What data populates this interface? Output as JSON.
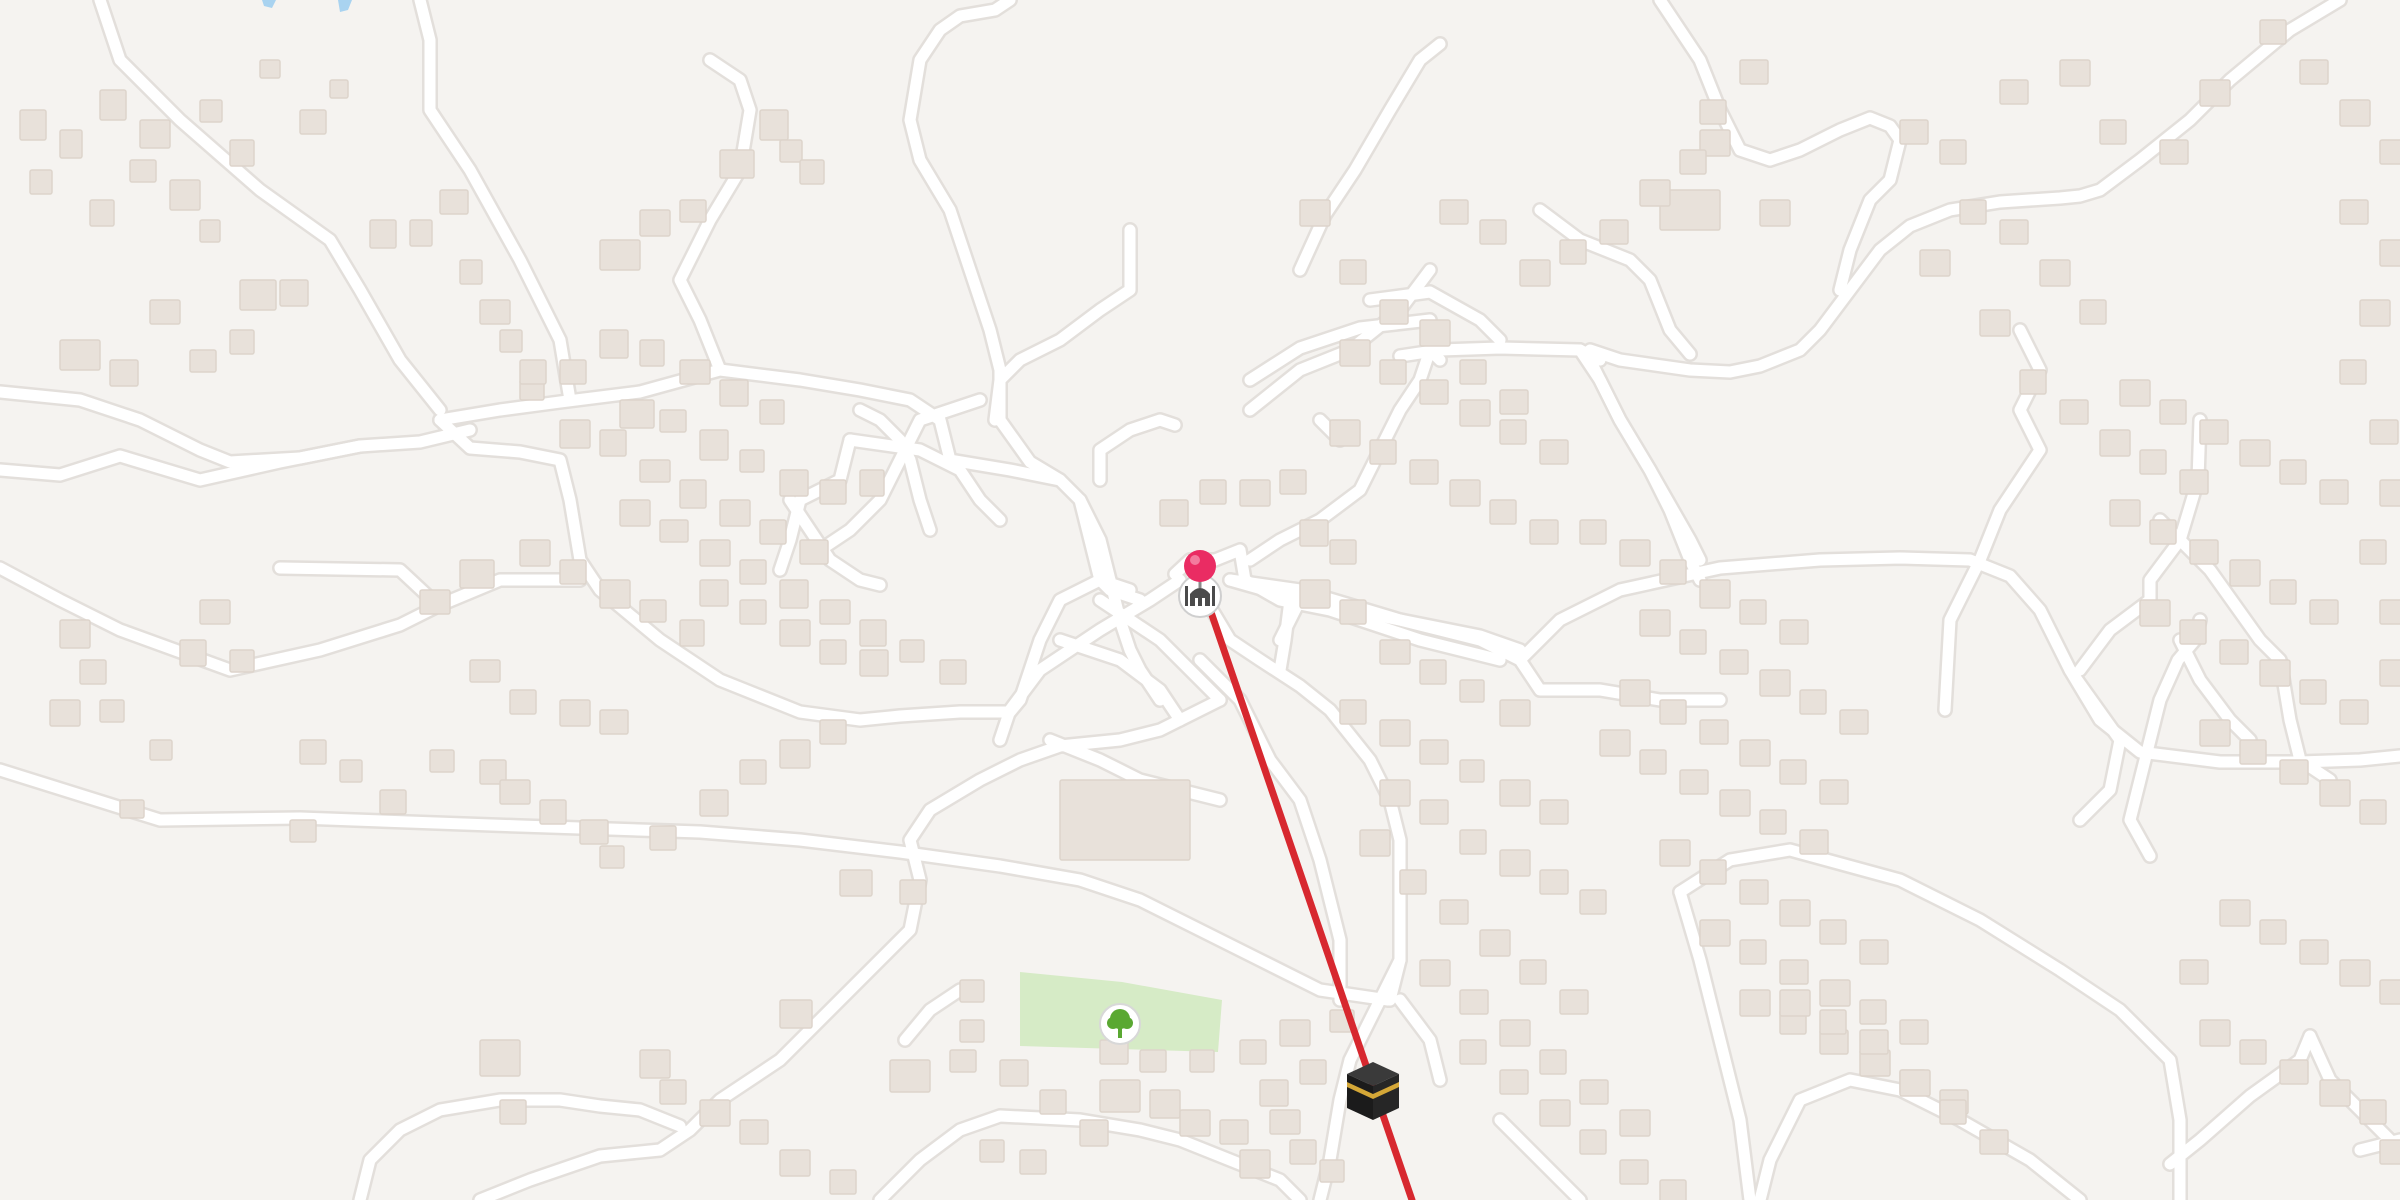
{
  "map": {
    "background_color": "#f5f3f0",
    "road_color": "#ffffff",
    "building_color": "#e8e1da",
    "park_color": "#d6ebc6",
    "water_color": "#a9d3f0"
  },
  "markers": {
    "location_pin": {
      "icon": "map-pin-icon",
      "color": "#ea2c63"
    },
    "mosque": {
      "icon": "mosque-icon"
    },
    "kaaba": {
      "icon": "kaaba-icon"
    },
    "park": {
      "icon": "tree-icon",
      "color": "#5aa832"
    }
  },
  "qibla_line": {
    "color": "#d7282f"
  }
}
